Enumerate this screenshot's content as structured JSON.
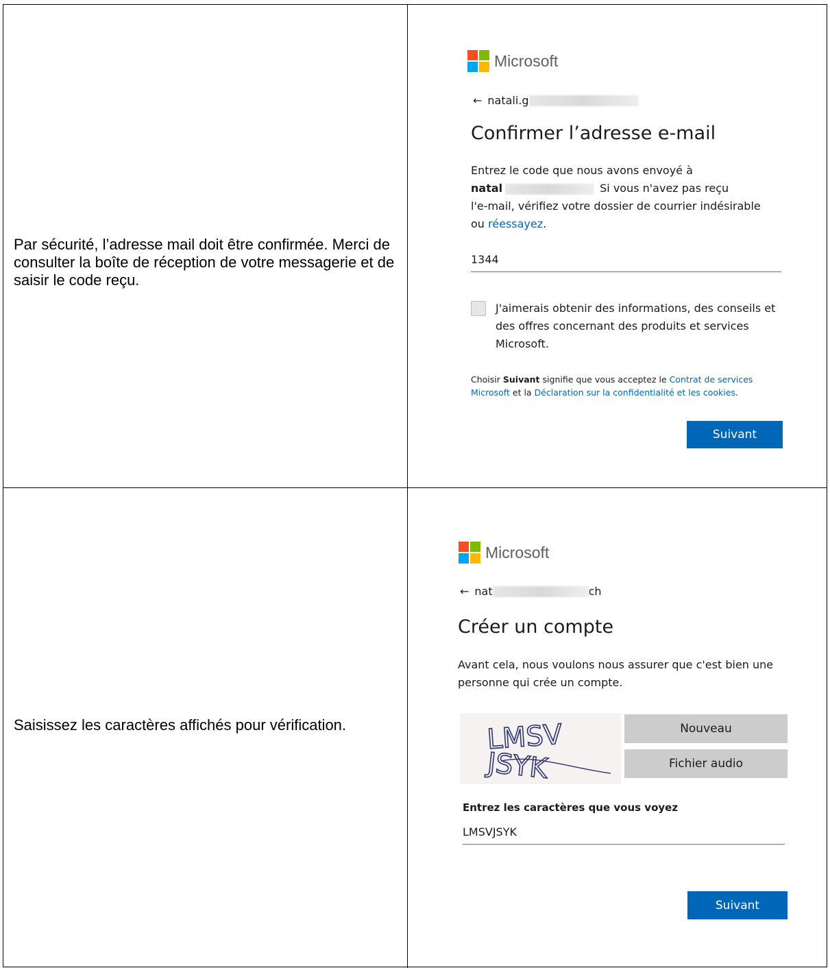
{
  "row1": {
    "instruction": "Par sécurité, l’adresse mail doit être confirmée. Merci de consulter la boîte de réception de votre messagerie et de saisir le code reçu.",
    "screen": {
      "logo_text": "Microsoft",
      "back_arrow": "←",
      "back_email": "natali.g",
      "title": "Confirmer l’adresse e-mail",
      "desc_1": "Entrez le code que nous avons envoyé à",
      "desc_bold": "natal",
      "desc_2": "Si vous n'avez pas reçu",
      "desc_3": "l'e-mail, vérifiez votre dossier de courrier indésirable",
      "desc_4": "ou",
      "retry_link": "réessayez",
      "code_value": "1344",
      "checkbox_label": "J'aimerais obtenir des informations, des conseils et des offres concernant des produits et services Microsoft.",
      "legal_1": "Choisir",
      "legal_bold": "Suivant",
      "legal_2": "signifie que vous acceptez le",
      "legal_link1": "Contrat de services Microsoft",
      "legal_3": "et la",
      "legal_link2": "Déclaration sur la confidentialité et les cookies",
      "legal_4": ".",
      "next_button": "Suivant"
    }
  },
  "row2": {
    "instruction": "Saisissez les caractères affichés pour vérification.",
    "screen": {
      "logo_text": "Microsoft",
      "back_arrow": "←",
      "back_email_start": "nat",
      "back_email_end": "ch",
      "title": "Créer un compte",
      "desc": "Avant cela, nous voulons nous assurer que c'est bien une personne qui crée un compte.",
      "new_button": "Nouveau",
      "audio_button": "Fichier audio",
      "captcha_line1": "LMSV",
      "captcha_line2": "JSYK",
      "field_label": "Entrez les caractères que vous voyez",
      "field_value": "LMSVJSYK",
      "next_button": "Suivant"
    }
  },
  "colors": {
    "accent": "#0067b8",
    "link": "#0067b8",
    "ms_red": "#f25022",
    "ms_green": "#7fba00",
    "ms_blue": "#00a4ef",
    "ms_yellow": "#ffb900"
  }
}
